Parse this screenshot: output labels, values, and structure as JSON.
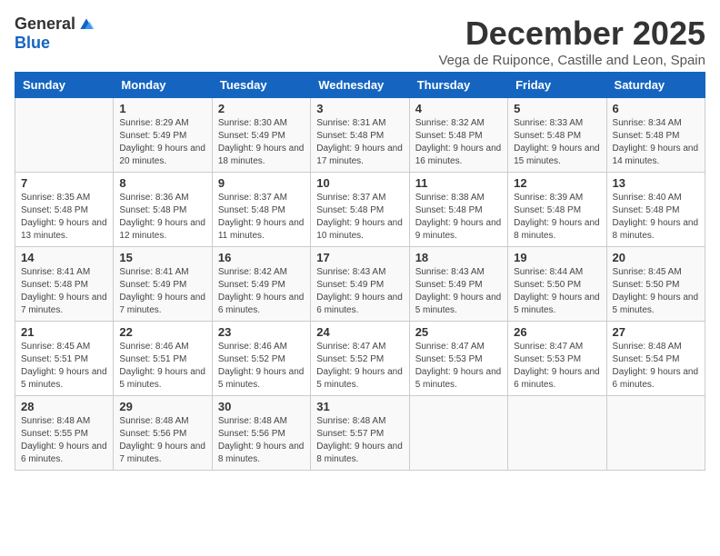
{
  "header": {
    "logo_general": "General",
    "logo_blue": "Blue",
    "month_title": "December 2025",
    "subtitle": "Vega de Ruiponce, Castille and Leon, Spain"
  },
  "days_of_week": [
    "Sunday",
    "Monday",
    "Tuesday",
    "Wednesday",
    "Thursday",
    "Friday",
    "Saturday"
  ],
  "weeks": [
    [
      {
        "day": "",
        "sunrise": "",
        "sunset": "",
        "daylight": ""
      },
      {
        "day": "1",
        "sunrise": "8:29 AM",
        "sunset": "5:49 PM",
        "daylight": "9 hours and 20 minutes."
      },
      {
        "day": "2",
        "sunrise": "8:30 AM",
        "sunset": "5:49 PM",
        "daylight": "9 hours and 18 minutes."
      },
      {
        "day": "3",
        "sunrise": "8:31 AM",
        "sunset": "5:48 PM",
        "daylight": "9 hours and 17 minutes."
      },
      {
        "day": "4",
        "sunrise": "8:32 AM",
        "sunset": "5:48 PM",
        "daylight": "9 hours and 16 minutes."
      },
      {
        "day": "5",
        "sunrise": "8:33 AM",
        "sunset": "5:48 PM",
        "daylight": "9 hours and 15 minutes."
      },
      {
        "day": "6",
        "sunrise": "8:34 AM",
        "sunset": "5:48 PM",
        "daylight": "9 hours and 14 minutes."
      }
    ],
    [
      {
        "day": "7",
        "sunrise": "8:35 AM",
        "sunset": "5:48 PM",
        "daylight": "9 hours and 13 minutes."
      },
      {
        "day": "8",
        "sunrise": "8:36 AM",
        "sunset": "5:48 PM",
        "daylight": "9 hours and 12 minutes."
      },
      {
        "day": "9",
        "sunrise": "8:37 AM",
        "sunset": "5:48 PM",
        "daylight": "9 hours and 11 minutes."
      },
      {
        "day": "10",
        "sunrise": "8:37 AM",
        "sunset": "5:48 PM",
        "daylight": "9 hours and 10 minutes."
      },
      {
        "day": "11",
        "sunrise": "8:38 AM",
        "sunset": "5:48 PM",
        "daylight": "9 hours and 9 minutes."
      },
      {
        "day": "12",
        "sunrise": "8:39 AM",
        "sunset": "5:48 PM",
        "daylight": "9 hours and 8 minutes."
      },
      {
        "day": "13",
        "sunrise": "8:40 AM",
        "sunset": "5:48 PM",
        "daylight": "9 hours and 8 minutes."
      }
    ],
    [
      {
        "day": "14",
        "sunrise": "8:41 AM",
        "sunset": "5:48 PM",
        "daylight": "9 hours and 7 minutes."
      },
      {
        "day": "15",
        "sunrise": "8:41 AM",
        "sunset": "5:49 PM",
        "daylight": "9 hours and 7 minutes."
      },
      {
        "day": "16",
        "sunrise": "8:42 AM",
        "sunset": "5:49 PM",
        "daylight": "9 hours and 6 minutes."
      },
      {
        "day": "17",
        "sunrise": "8:43 AM",
        "sunset": "5:49 PM",
        "daylight": "9 hours and 6 minutes."
      },
      {
        "day": "18",
        "sunrise": "8:43 AM",
        "sunset": "5:49 PM",
        "daylight": "9 hours and 5 minutes."
      },
      {
        "day": "19",
        "sunrise": "8:44 AM",
        "sunset": "5:50 PM",
        "daylight": "9 hours and 5 minutes."
      },
      {
        "day": "20",
        "sunrise": "8:45 AM",
        "sunset": "5:50 PM",
        "daylight": "9 hours and 5 minutes."
      }
    ],
    [
      {
        "day": "21",
        "sunrise": "8:45 AM",
        "sunset": "5:51 PM",
        "daylight": "9 hours and 5 minutes."
      },
      {
        "day": "22",
        "sunrise": "8:46 AM",
        "sunset": "5:51 PM",
        "daylight": "9 hours and 5 minutes."
      },
      {
        "day": "23",
        "sunrise": "8:46 AM",
        "sunset": "5:52 PM",
        "daylight": "9 hours and 5 minutes."
      },
      {
        "day": "24",
        "sunrise": "8:47 AM",
        "sunset": "5:52 PM",
        "daylight": "9 hours and 5 minutes."
      },
      {
        "day": "25",
        "sunrise": "8:47 AM",
        "sunset": "5:53 PM",
        "daylight": "9 hours and 5 minutes."
      },
      {
        "day": "26",
        "sunrise": "8:47 AM",
        "sunset": "5:53 PM",
        "daylight": "9 hours and 6 minutes."
      },
      {
        "day": "27",
        "sunrise": "8:48 AM",
        "sunset": "5:54 PM",
        "daylight": "9 hours and 6 minutes."
      }
    ],
    [
      {
        "day": "28",
        "sunrise": "8:48 AM",
        "sunset": "5:55 PM",
        "daylight": "9 hours and 6 minutes."
      },
      {
        "day": "29",
        "sunrise": "8:48 AM",
        "sunset": "5:56 PM",
        "daylight": "9 hours and 7 minutes."
      },
      {
        "day": "30",
        "sunrise": "8:48 AM",
        "sunset": "5:56 PM",
        "daylight": "9 hours and 8 minutes."
      },
      {
        "day": "31",
        "sunrise": "8:48 AM",
        "sunset": "5:57 PM",
        "daylight": "9 hours and 8 minutes."
      },
      {
        "day": "",
        "sunrise": "",
        "sunset": "",
        "daylight": ""
      },
      {
        "day": "",
        "sunrise": "",
        "sunset": "",
        "daylight": ""
      },
      {
        "day": "",
        "sunrise": "",
        "sunset": "",
        "daylight": ""
      }
    ]
  ],
  "labels": {
    "sunrise_prefix": "Sunrise: ",
    "sunset_prefix": "Sunset: ",
    "daylight_prefix": "Daylight: "
  }
}
